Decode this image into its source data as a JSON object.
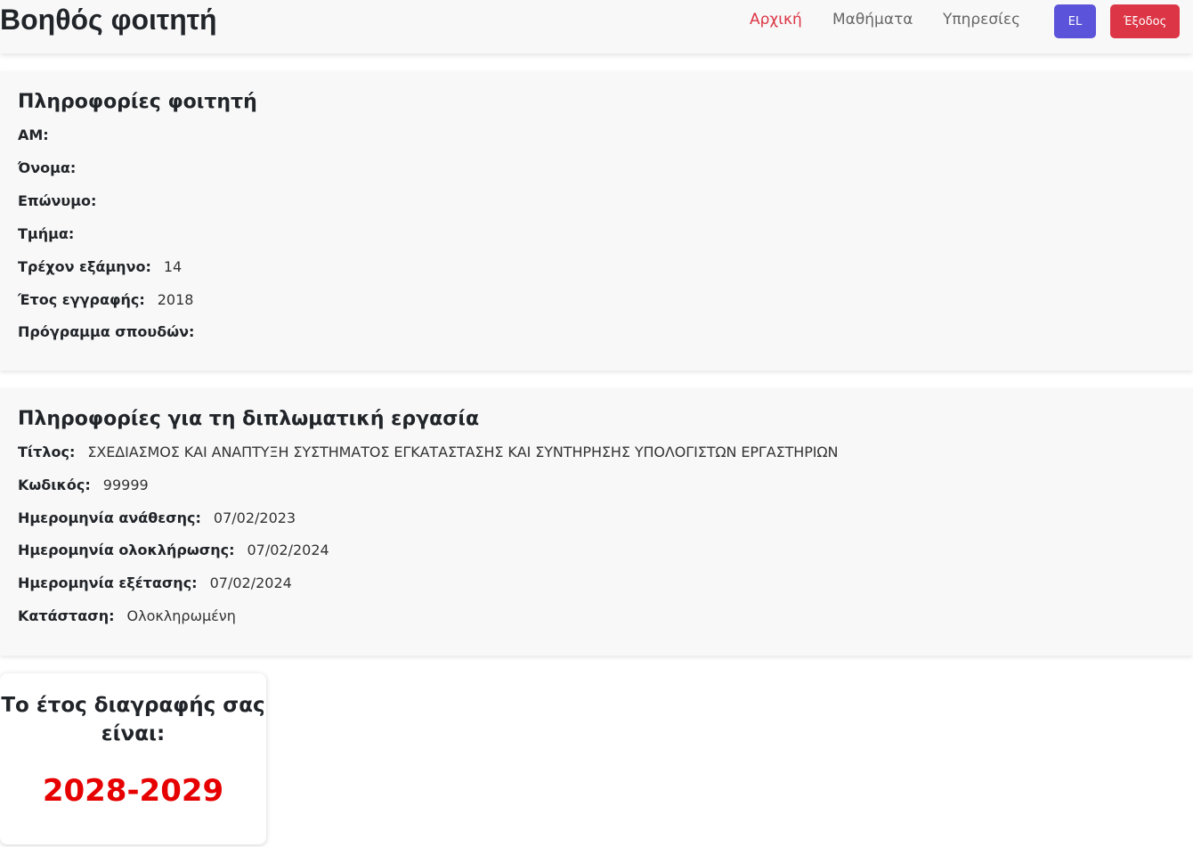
{
  "navbar": {
    "brand": "Βοηθός φοιτητή",
    "links": [
      {
        "label": "Αρχική",
        "active": true
      },
      {
        "label": "Μαθήματα",
        "active": false
      },
      {
        "label": "Υπηρεσίες",
        "active": false
      }
    ],
    "lang_button": "EL",
    "logout_button": "Έξοδος"
  },
  "student_info": {
    "title": "Πληροφορίες φοιτητή",
    "fields": [
      {
        "label": "ΑΜ:",
        "value": ""
      },
      {
        "label": "Όνομα:",
        "value": ""
      },
      {
        "label": "Επώνυμο:",
        "value": ""
      },
      {
        "label": "Τμήμα:",
        "value": ""
      },
      {
        "label": "Τρέχον εξάμηνο:",
        "value": "14"
      },
      {
        "label": "Έτος εγγραφής:",
        "value": "2018"
      },
      {
        "label": "Πρόγραμμα σπουδών:",
        "value": ""
      }
    ]
  },
  "thesis_info": {
    "title": "Πληροφορίες για τη διπλωματική εργασία",
    "fields": [
      {
        "label": "Τίτλος:",
        "value": "ΣΧΕΔΙΑΣΜΟΣ ΚΑΙ ΑΝΑΠΤΥΞΗ ΣΥΣΤΗΜΑΤΟΣ ΕΓΚΑΤΑΣΤΑΣΗΣ ΚΑΙ ΣΥΝΤΗΡΗΣΗΣ ΥΠΟΛΟΓΙΣΤΩΝ ΕΡΓΑΣΤΗΡΙΩΝ"
      },
      {
        "label": "Κωδικός:",
        "value": "99999"
      },
      {
        "label": "Ημερομηνία ανάθεσης:",
        "value": "07/02/2023"
      },
      {
        "label": "Ημερομηνία ολοκλήρωσης:",
        "value": "07/02/2024"
      },
      {
        "label": "Ημερομηνία εξέτασης:",
        "value": "07/02/2024"
      },
      {
        "label": "Κατάσταση:",
        "value": "Ολοκληρωμένη"
      }
    ]
  },
  "expiry": {
    "line1": "Το έτος διαγραφής σας",
    "line2": "είναι:",
    "year": "2028-2029"
  },
  "colors": {
    "accent_red": "#dc3545",
    "lang_purple": "#5b53d9",
    "expiry_red": "#e60000"
  }
}
